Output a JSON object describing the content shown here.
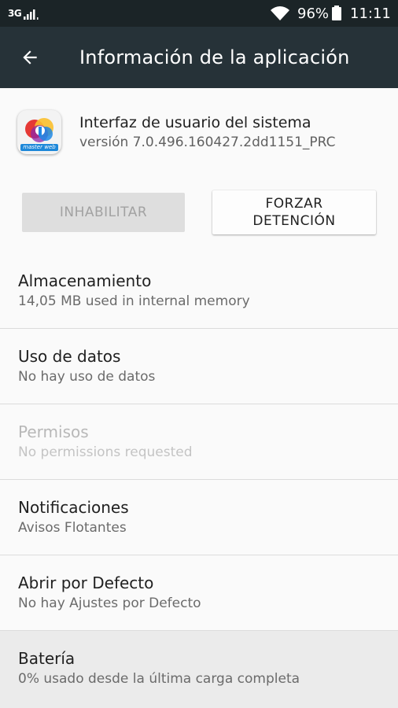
{
  "status_bar": {
    "network": "3G",
    "battery_percent": "96%",
    "time": "11:11",
    "icons": [
      "signal-icon",
      "wifi-icon",
      "battery-icon"
    ]
  },
  "app_bar": {
    "title": "Información de la aplicación",
    "back_icon": "arrow-back-icon",
    "background": "#263238"
  },
  "app": {
    "name": "Interfaz de usuario del sistema",
    "version": "versión 7.0.496.160427.2dd1151_PRC",
    "icon_label": "master web"
  },
  "buttons": {
    "disable": "INHABILITAR",
    "force_stop": "FORZAR\nDETENCIÓN"
  },
  "items": [
    {
      "title": "Almacenamiento",
      "subtitle": "14,05 MB used in internal memory"
    },
    {
      "title": "Uso de datos",
      "subtitle": "No hay uso de datos"
    },
    {
      "title": "Permisos",
      "subtitle": "No permissions requested"
    },
    {
      "title": "Notificaciones",
      "subtitle": "Avisos Flotantes"
    },
    {
      "title": "Abrir por Defecto",
      "subtitle": "No hay Ajustes por Defecto"
    },
    {
      "title": "Batería",
      "subtitle": "0% usado desde la última carga completa"
    }
  ]
}
